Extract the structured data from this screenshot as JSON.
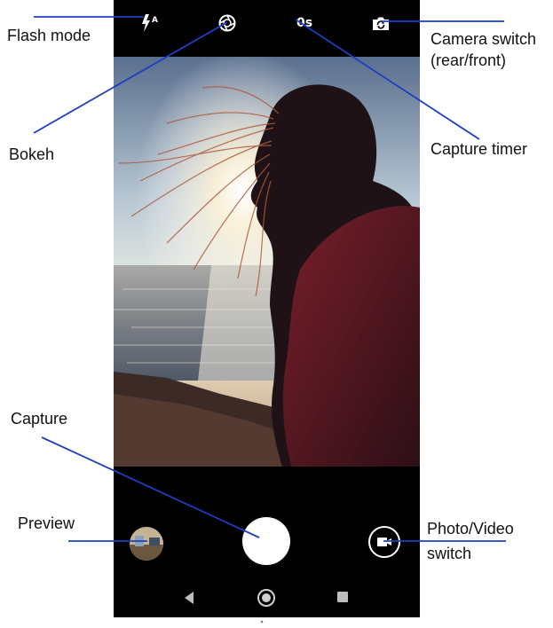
{
  "camera": {
    "top_bar": {
      "timer_label": "0s"
    },
    "icons": {
      "flash": "flash-auto-icon",
      "bokeh": "bokeh-icon",
      "camera_switch": "camera-switch-icon",
      "photo_video": "video-camera-icon"
    },
    "colors": {
      "annotation_line": "#1c3fc1",
      "bar_background": "#000000"
    }
  },
  "annotations": {
    "flash_mode": "Flash mode",
    "bokeh": "Bokeh",
    "capture_timer": "Capture timer",
    "camera_switch_line1": "Camera switch",
    "camera_switch_line2": "(rear/front)",
    "capture": "Capture",
    "preview": "Preview",
    "photo_video_line1": "Photo/Video",
    "photo_video_line2": "switch"
  }
}
